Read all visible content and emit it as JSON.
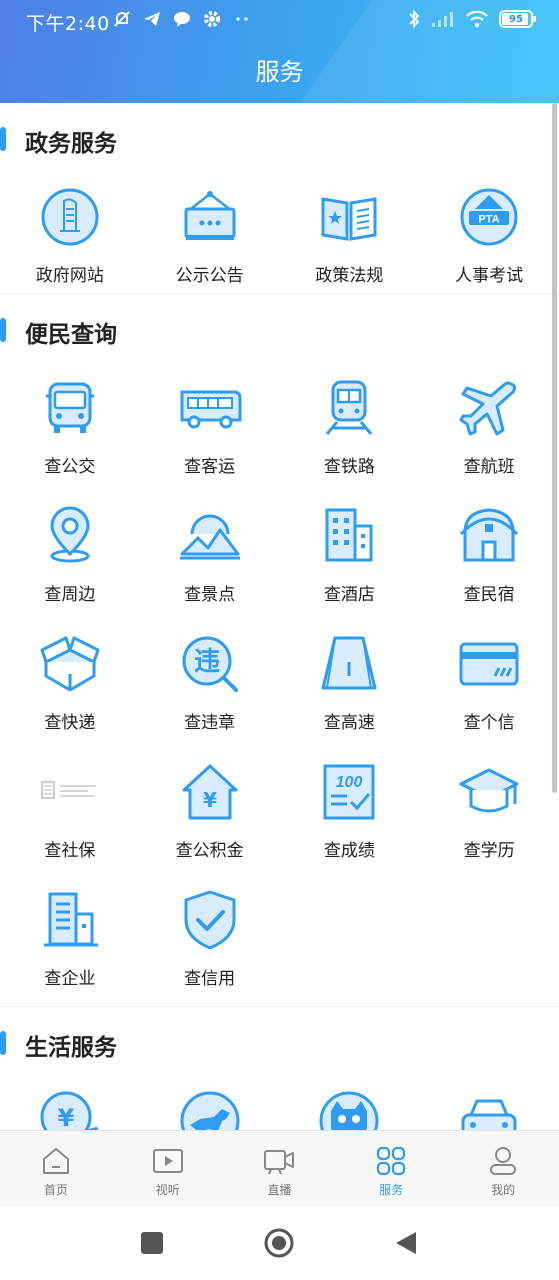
{
  "status_bar": {
    "time": "下午2:40",
    "battery": "95"
  },
  "header": {
    "title": "服务"
  },
  "sections": [
    {
      "title": "政务服务",
      "items": [
        {
          "label": "政府网站",
          "icon": "emblem-icon"
        },
        {
          "label": "公示公告",
          "icon": "notice-board-icon"
        },
        {
          "label": "政策法规",
          "icon": "open-book-icon"
        },
        {
          "label": "人事考试",
          "icon": "pta-icon"
        }
      ]
    },
    {
      "title": "便民查询",
      "items": [
        {
          "label": "查公交",
          "icon": "bus-icon"
        },
        {
          "label": "查客运",
          "icon": "coach-icon"
        },
        {
          "label": "查铁路",
          "icon": "train-icon"
        },
        {
          "label": "查航班",
          "icon": "plane-icon"
        },
        {
          "label": "查周边",
          "icon": "location-pin-icon"
        },
        {
          "label": "查景点",
          "icon": "mountain-sun-icon"
        },
        {
          "label": "查酒店",
          "icon": "hotel-building-icon"
        },
        {
          "label": "查民宿",
          "icon": "barn-house-icon"
        },
        {
          "label": "查快递",
          "icon": "box-icon"
        },
        {
          "label": "查违章",
          "icon": "violation-magnifier-icon"
        },
        {
          "label": "查高速",
          "icon": "highway-icon"
        },
        {
          "label": "查个信",
          "icon": "credit-card-icon"
        },
        {
          "label": "查社保",
          "icon": "social-security-logo-icon"
        },
        {
          "label": "查公积金",
          "icon": "house-fund-icon"
        },
        {
          "label": "查成绩",
          "icon": "score-sheet-icon"
        },
        {
          "label": "查学历",
          "icon": "graduation-cap-icon"
        },
        {
          "label": "查企业",
          "icon": "enterprise-building-icon"
        },
        {
          "label": "查信用",
          "icon": "shield-check-icon"
        }
      ]
    },
    {
      "title": "生活服务",
      "items": [
        {
          "label": "",
          "icon": "yuan-payment-icon"
        },
        {
          "label": "",
          "icon": "dog-icon"
        },
        {
          "label": "",
          "icon": "cat-icon"
        },
        {
          "label": "",
          "icon": "car-icon"
        }
      ]
    }
  ],
  "tabs": [
    {
      "label": "首页",
      "icon": "home-icon",
      "active": false
    },
    {
      "label": "视听",
      "icon": "video-play-icon",
      "active": false
    },
    {
      "label": "直播",
      "icon": "camera-icon",
      "active": false
    },
    {
      "label": "服务",
      "icon": "grid-icon",
      "active": true
    },
    {
      "label": "我的",
      "icon": "user-icon",
      "active": false
    }
  ],
  "colors": {
    "primary": "#2f9cf4",
    "header_start": "#4f7fe6",
    "header_end": "#39c3f7",
    "icon_fill": "#d9ecfd"
  }
}
